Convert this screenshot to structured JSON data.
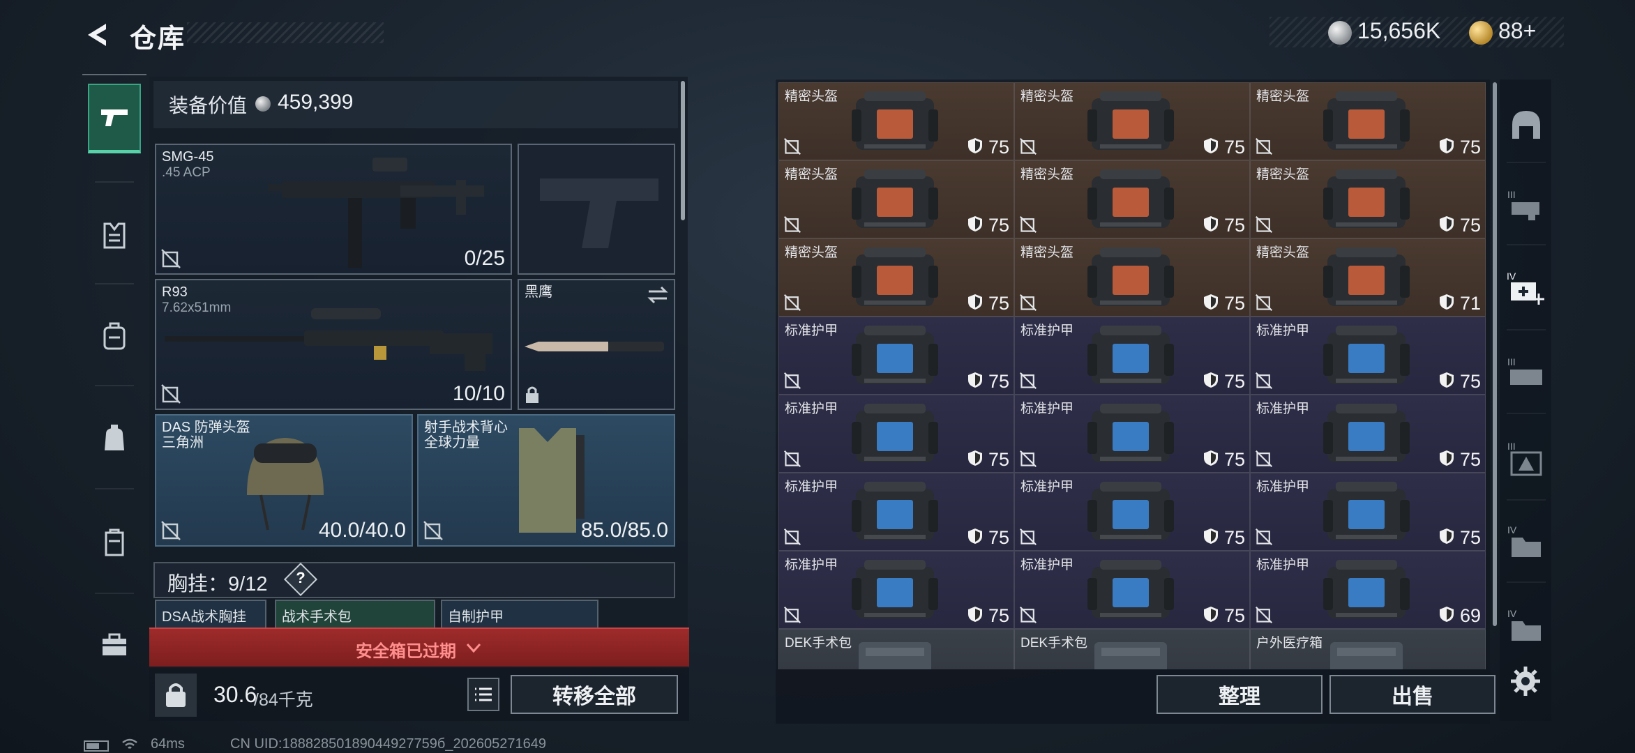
{
  "header": {
    "title": "仓库",
    "currency_silver": "15,656K",
    "currency_gold": "88+"
  },
  "left_nav": [
    "weapons-icon",
    "vest-icon",
    "backpack-icon",
    "bag-icon",
    "case-icon",
    "briefcase-icon"
  ],
  "equipment": {
    "value_label": "装备价值",
    "value_amount": "459,399",
    "primary": {
      "name": "SMG-45",
      "ammo_type": ".45 ACP",
      "count": "0/25"
    },
    "secondary": {
      "name": "R93",
      "ammo_type": "7.62x51mm",
      "count": "10/10"
    },
    "melee": {
      "name": "黑鹰"
    },
    "helmet": {
      "name": "DAS 防弹头盔",
      "brand": "三角洲",
      "durability": "40.0/40.0"
    },
    "armor": {
      "name": "射手战术背心",
      "brand": "全球力量",
      "durability": "85.0/85.0"
    },
    "chest_rig_label": "胸挂",
    "chest_rig_capacity": "9/12",
    "help_label": "?",
    "mini_slots": [
      "DSA战术胸挂",
      "战术手术包",
      "自制护甲"
    ],
    "expired_text": "安全箱已过期",
    "weight_current": "30.6",
    "weight_max": "/84千克",
    "transfer_all": "转移全部"
  },
  "storage": {
    "items": [
      {
        "name": "精密头盔",
        "value": "75",
        "tone": "brown"
      },
      {
        "name": "精密头盔",
        "value": "75",
        "tone": "brown"
      },
      {
        "name": "精密头盔",
        "value": "75",
        "tone": "brown"
      },
      {
        "name": "精密头盔",
        "value": "75",
        "tone": "brown"
      },
      {
        "name": "精密头盔",
        "value": "75",
        "tone": "brown"
      },
      {
        "name": "精密头盔",
        "value": "75",
        "tone": "brown"
      },
      {
        "name": "精密头盔",
        "value": "75",
        "tone": "brown"
      },
      {
        "name": "精密头盔",
        "value": "75",
        "tone": "brown"
      },
      {
        "name": "精密头盔",
        "value": "71",
        "tone": "brown"
      },
      {
        "name": "标准护甲",
        "value": "75",
        "tone": "purple"
      },
      {
        "name": "标准护甲",
        "value": "75",
        "tone": "purple"
      },
      {
        "name": "标准护甲",
        "value": "75",
        "tone": "purple"
      },
      {
        "name": "标准护甲",
        "value": "75",
        "tone": "purple"
      },
      {
        "name": "标准护甲",
        "value": "75",
        "tone": "purple"
      },
      {
        "name": "标准护甲",
        "value": "75",
        "tone": "purple"
      },
      {
        "name": "标准护甲",
        "value": "75",
        "tone": "purple"
      },
      {
        "name": "标准护甲",
        "value": "75",
        "tone": "purple"
      },
      {
        "name": "标准护甲",
        "value": "75",
        "tone": "purple"
      },
      {
        "name": "标准护甲",
        "value": "75",
        "tone": "purple"
      },
      {
        "name": "标准护甲",
        "value": "75",
        "tone": "purple"
      },
      {
        "name": "标准护甲",
        "value": "69",
        "tone": "purple"
      },
      {
        "name": "DEK手术包",
        "value": "",
        "tone": "grey"
      },
      {
        "name": "DEK手术包",
        "value": "",
        "tone": "grey"
      },
      {
        "name": "户外医疗箱",
        "value": "",
        "tone": "grey"
      }
    ],
    "tidy": "整理",
    "sell": "出售"
  },
  "right_nav": [
    "helmet-slot-icon",
    "weapon-iii-icon",
    "medkit-iv-icon",
    "gear-iii-icon",
    "warning-iii-icon",
    "folder-iv-icon",
    "folder-iv-2-icon"
  ],
  "status": {
    "ping": "64ms",
    "uid": "CN UID:18882850189044927759б_202605271649"
  },
  "colors": {
    "accent_green": "#3aa583",
    "expired_red": "#9e2b2b",
    "helmet_cell": "#4a3a30",
    "armor_cell": "#2f2e48"
  }
}
